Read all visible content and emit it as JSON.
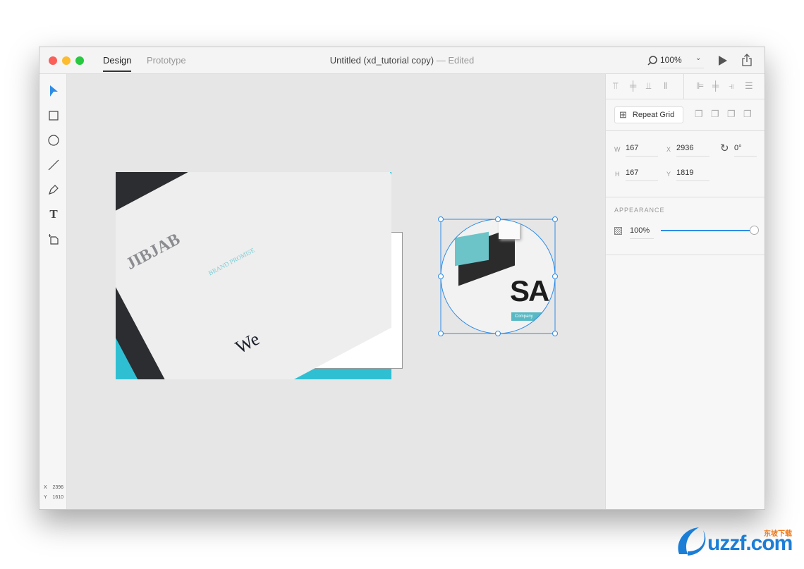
{
  "window": {
    "title": "Untitled (xd_tutorial copy)",
    "title_suffix": "— Edited",
    "tabs": [
      {
        "label": "Design",
        "active": true
      },
      {
        "label": "Prototype",
        "active": false
      }
    ],
    "zoom": "100%"
  },
  "toolbar": {
    "tools": [
      "select-icon",
      "rectangle-icon",
      "ellipse-icon",
      "line-icon",
      "pen-icon",
      "text-icon",
      "artboard-icon"
    ],
    "cursor": {
      "x_label": "X",
      "x": "2396",
      "y_label": "Y",
      "y": "1610"
    }
  },
  "canvas": {
    "image1": {
      "cover_text": "JIBJAB",
      "heading": "BRAND PROMISE",
      "big_text": "We"
    },
    "image2": {
      "big_text": "SA",
      "tag": "Company"
    }
  },
  "panel": {
    "repeat_grid": "Repeat Grid",
    "w_label": "W",
    "w": "167",
    "h_label": "H",
    "h": "167",
    "x_label": "X",
    "x": "2936",
    "y_label": "Y",
    "y": "1819",
    "rotation": "0°",
    "appearance_label": "APPEARANCE",
    "opacity": "100%",
    "opacity_value": 100
  },
  "watermark": {
    "text": "uzzf.com",
    "sub": "东坡下载"
  },
  "colors": {
    "accent": "#2d8ce6",
    "close": "#fc5f57",
    "minimize": "#fdbc2e",
    "maximize": "#28c840",
    "teal": "#33c1d6"
  }
}
